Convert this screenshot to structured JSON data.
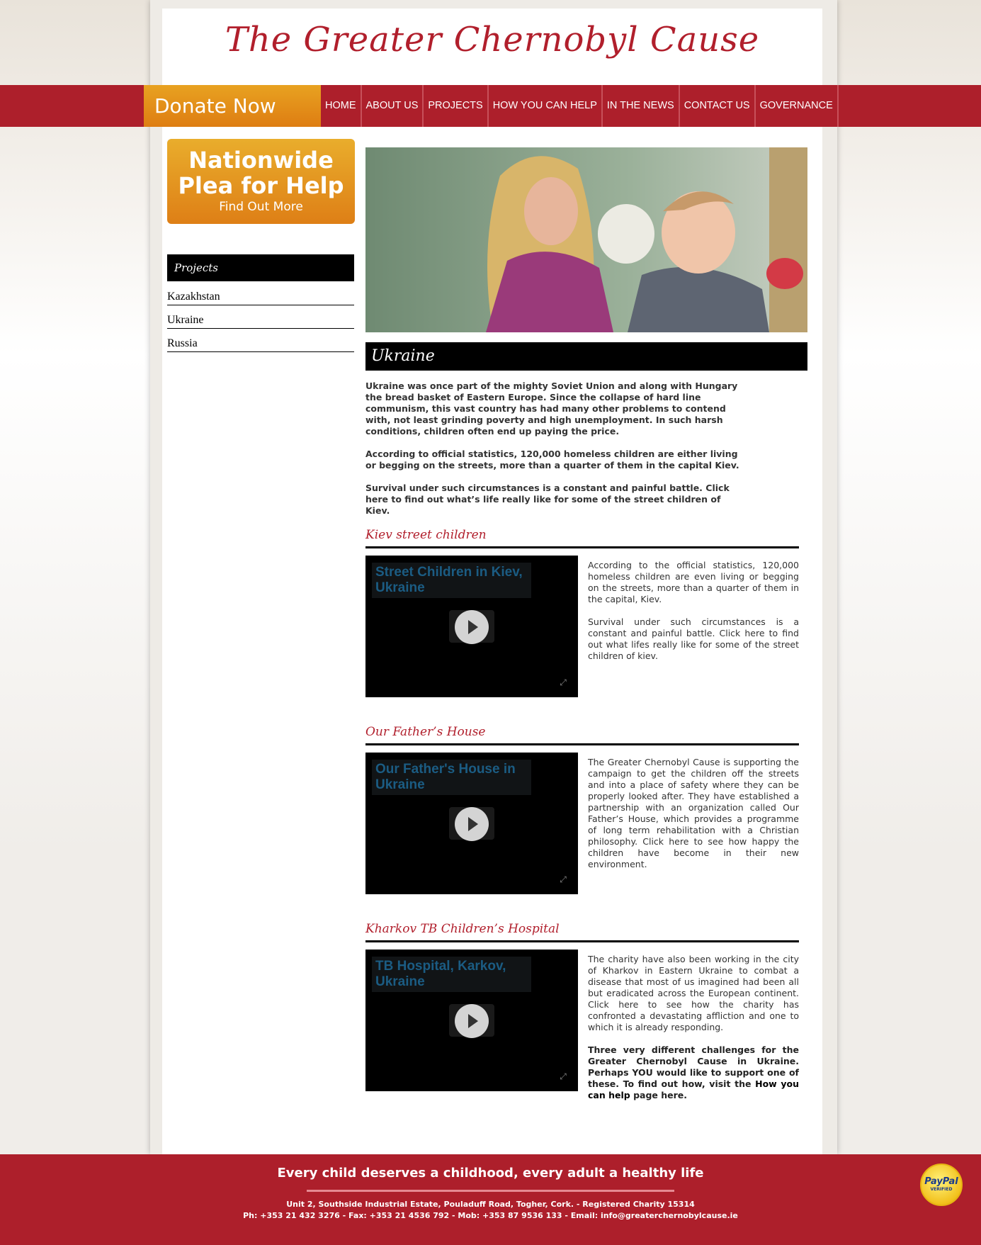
{
  "header": {
    "site_title": "The Greater Chernobyl Cause"
  },
  "nav": {
    "donate_label": "Donate Now",
    "items": [
      {
        "label": "HOME"
      },
      {
        "label": "ABOUT US"
      },
      {
        "label": "PROJECTS"
      },
      {
        "label": "HOW YOU CAN HELP"
      },
      {
        "label": "IN THE NEWS"
      },
      {
        "label": "CONTACT US"
      },
      {
        "label": "GOVERNANCE"
      }
    ]
  },
  "sidebar": {
    "plea": {
      "title": "Nationwide Plea for Help",
      "subtitle": "Find Out More"
    },
    "heading": "Projects",
    "links": [
      "Kazakhstan",
      "Ukraine",
      "Russia"
    ]
  },
  "main": {
    "heading": "Ukraine",
    "intro": [
      "Ukraine was once part of the mighty Soviet Union and along with Hungary the bread basket of Eastern Europe. Since the collapse of hard line communism, this vast country has had many other problems to contend with, not least grinding poverty and high unemployment. In such harsh conditions, children often end up paying the price.",
      "According to official statistics, 120,000 homeless children are either living or begging on the streets, more than a quarter of them in the capital Kiev.",
      "Survival under such circumstances is a constant and painful battle. Click here to find out what’s life really like for some of the street children of Kiev."
    ],
    "sections": [
      {
        "title": "Kiev street children",
        "video_title": "Street Children in Kiev, Ukraine",
        "paragraphs": [
          "According to the official statistics, 120,000 homeless children are even living or begging on the streets, more than a quarter of them in the capital, Kiev.",
          "Survival under such circumstances is a constant and painful battle. Click here to find out what lifes really like for some of the street children of kiev."
        ]
      },
      {
        "title": "Our Father’s House",
        "video_title": "Our Father's House in Ukraine",
        "paragraphs": [
          "The Greater Chernobyl Cause is supporting the campaign to get the children off the streets and into a place of safety where they can be properly looked after. They have established a partnership with an organization called Our Father’s House, which provides a programme of long term rehabilitation with a Christian philosophy. Click here to see how happy the children have become in their new environment."
        ]
      },
      {
        "title": "Kharkov TB Children’s Hospital",
        "video_title": "TB Hospital, Karkov, Ukraine",
        "paragraphs": [
          "The charity have also been working in the city of Kharkov in Eastern Ukraine to combat a disease that most of us imagined had been all but eradicated across the European continent. Click here to see how the charity has confronted a devastating affliction and one to which it is already responding."
        ],
        "closing": {
          "before": "Three very different challenges for the Greater Chernobyl Cause in Ukraine. Perhaps YOU would like to support one of these. To find out how, visit the ",
          "link": "How you can help",
          "after": " page here."
        }
      }
    ]
  },
  "footer": {
    "slogan": "Every child deserves a childhood, every adult a healthy life",
    "address": "Unit 2, Southside Industrial Estate, Pouladuff Road, Togher, Cork. - Registered Charity 15314",
    "contact": "Ph: +353 21 432 3276 - Fax: +353 21 4536 792 - Mob: +353 87 9536 133 - Email: info@greaterchernobylcause.ie",
    "paypal_brand": "PayPal",
    "paypal_badge": "VERIFIED"
  },
  "colors": {
    "brand_red": "#ad1f2b",
    "donate_orange": "#e08a18",
    "title_red": "#b11f2c"
  },
  "icons": {
    "play": "play-icon",
    "fullscreen": "fullscreen-icon"
  }
}
